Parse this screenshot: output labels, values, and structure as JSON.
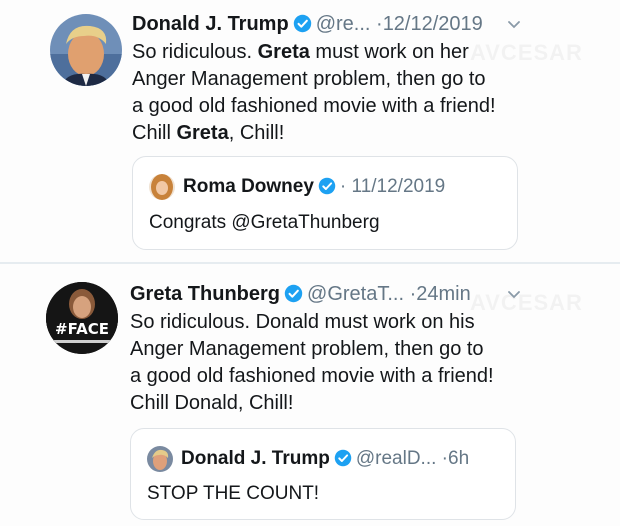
{
  "tweet1": {
    "name": "Donald J. Trump",
    "handle": "@re...",
    "separator": "·",
    "time": "12/12/2019",
    "text_parts": [
      "So ridiculous. ",
      "Greta",
      " must work on her",
      "Anger Management problem, then go to",
      "a good old fashioned movie with a friend!",
      "Chill ",
      "Greta",
      ", Chill!"
    ],
    "quote": {
      "name": "Roma Downey",
      "separator": "·",
      "time": "11/12/2019",
      "text": "Congrats @GretaThunberg"
    }
  },
  "tweet2": {
    "name": "Greta Thunberg",
    "handle": "@GretaT...",
    "separator": "·",
    "time": "24min",
    "avatar_label": "#FACE",
    "text_lines": [
      "So ridiculous. Donald must work on his",
      "Anger Management problem, then go to",
      "a good old fashioned movie with a friend!",
      "Chill Donald, Chill!"
    ],
    "quote": {
      "name": "Donald J. Trump",
      "handle": "@realD...",
      "separator": "·",
      "time": "6h",
      "text": "STOP THE COUNT!"
    }
  },
  "colors": {
    "verified": "#1da1f2",
    "secondary_text": "#657786",
    "border": "#dfe3e7"
  },
  "icons": [
    "verified-badge-icon",
    "chevron-down-icon"
  ]
}
